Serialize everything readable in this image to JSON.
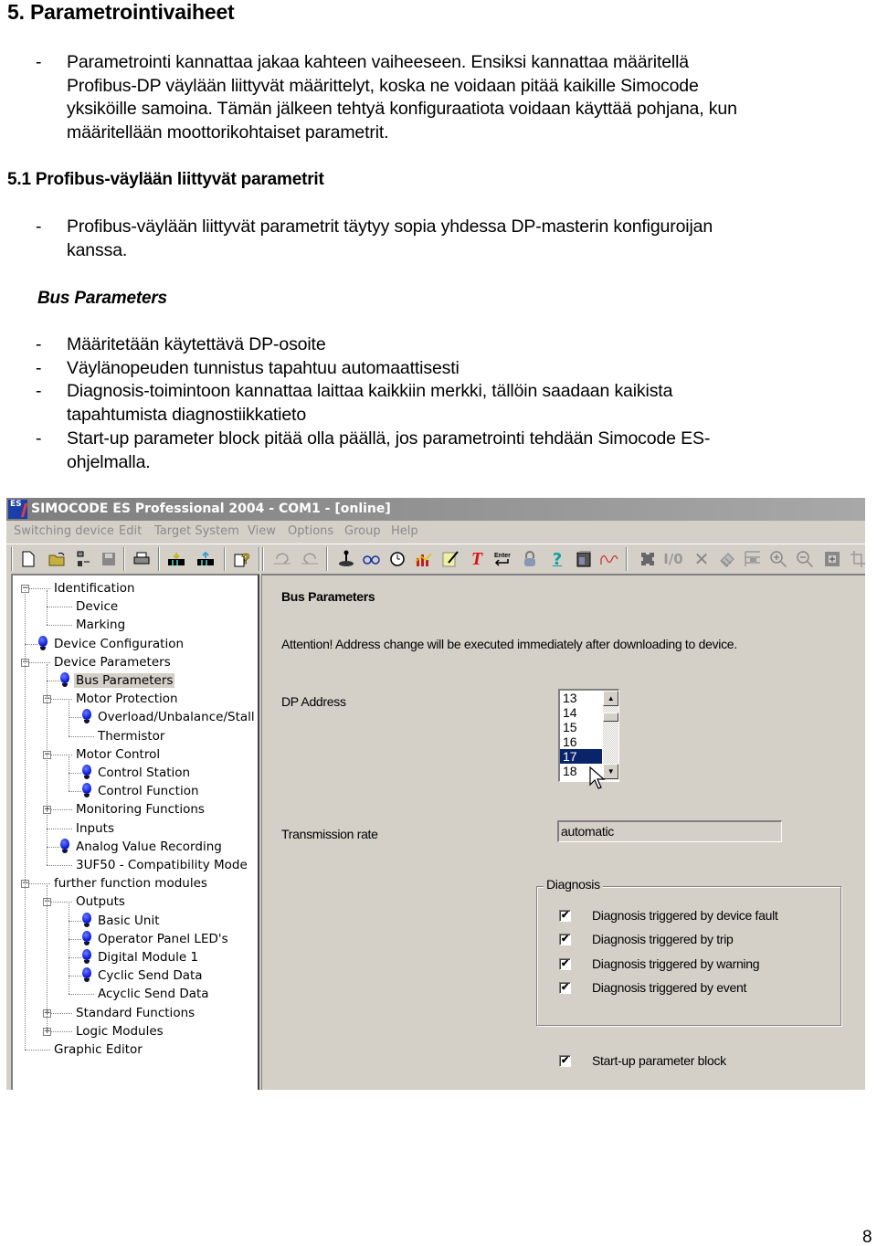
{
  "document": {
    "heading": "5. Parametrointivaiheet",
    "intro_bullets": [
      {
        "dash": "-",
        "lines": [
          "Parametrointi kannattaa jakaa kahteen vaiheeseen. Ensiksi kannattaa määritellä",
          "Profibus-DP väylään liittyvät määrittelyt, koska ne voidaan pitää kaikille Simocode",
          "yksiköille samoina. Tämän jälkeen tehtyä konfiguraatiota voidaan käyttää pohjana, kun",
          "määritellään moottorikohtaiset parametrit."
        ]
      }
    ],
    "subheading": "5.1 Profibus-väylään liittyvät parametrit",
    "sub_bullets": [
      {
        "dash": "-",
        "lines": [
          "Profibus-väylään liittyvät parametrit täytyy sopia yhdessa DP-masterin konfiguroijan",
          "kanssa."
        ]
      }
    ],
    "section_label": "Bus Parameters",
    "bus_bullets": [
      {
        "dash": "-",
        "lines": [
          "Määritetään käytettävä DP-osoite"
        ]
      },
      {
        "dash": "-",
        "lines": [
          "Väylänopeuden tunnistus tapahtuu automaattisesti"
        ]
      },
      {
        "dash": "-",
        "lines": [
          "Diagnosis-toimintoon kannattaa laittaa kaikkiin merkki, tällöin saadaan kaikista",
          "tapahtumista diagnostiikkatieto"
        ]
      },
      {
        "dash": "-",
        "lines": [
          "Start-up parameter block pitää olla päällä, jos parametrointi tehdään Simocode ES-",
          "ohjelmalla."
        ]
      }
    ],
    "page_number": "8"
  },
  "screenshot": {
    "title": "SIMOCODE ES Professional 2004 - COM1 - [online]",
    "app_icon_text": "ES",
    "menu": [
      "Switching device",
      "Edit",
      "Target System",
      "View",
      "Options",
      "Group",
      "Help"
    ],
    "toolbar_icons": [
      "new-document",
      "open-folder",
      "network-connect",
      "save",
      "print",
      "download-to-device",
      "upload-from-device",
      "help-context",
      "undo",
      "redo",
      "joystick-control",
      "glasses-view",
      "stopwatch-test",
      "chart-diagnostics",
      "notepad-edit",
      "text-tool",
      "enter-key",
      "lock",
      "help",
      "device-module",
      "waveform",
      "puzzle-piece",
      "io-toggle",
      "delete",
      "pencil-grid",
      "layout",
      "zoom-in",
      "zoom-out",
      "fit-window",
      "crop"
    ],
    "tree": [
      {
        "label": "Identification",
        "level": 0,
        "expander": "-",
        "bulb": false
      },
      {
        "label": "Device",
        "level": 1,
        "expander": "",
        "bulb": false
      },
      {
        "label": "Marking",
        "level": 1,
        "expander": "",
        "bulb": false
      },
      {
        "label": "Device Configuration",
        "level": 0,
        "expander": "",
        "bulb": true
      },
      {
        "label": "Device Parameters",
        "level": 0,
        "expander": "-",
        "bulb": false
      },
      {
        "label": "Bus Parameters",
        "level": 1,
        "expander": "",
        "bulb": true,
        "selected": true
      },
      {
        "label": "Motor Protection",
        "level": 1,
        "expander": "-",
        "bulb": false
      },
      {
        "label": "Overload/Unbalance/Stall",
        "level": 2,
        "expander": "",
        "bulb": true
      },
      {
        "label": "Thermistor",
        "level": 2,
        "expander": "",
        "bulb": false
      },
      {
        "label": "Motor Control",
        "level": 1,
        "expander": "-",
        "bulb": false
      },
      {
        "label": "Control Station",
        "level": 2,
        "expander": "",
        "bulb": true
      },
      {
        "label": "Control Function",
        "level": 2,
        "expander": "",
        "bulb": true
      },
      {
        "label": "Monitoring Functions",
        "level": 1,
        "expander": "+",
        "bulb": false
      },
      {
        "label": "Inputs",
        "level": 1,
        "expander": "",
        "bulb": false
      },
      {
        "label": "Analog Value Recording",
        "level": 1,
        "expander": "",
        "bulb": true
      },
      {
        "label": "3UF50 - Compatibility Mode",
        "level": 1,
        "expander": "",
        "bulb": false
      },
      {
        "label": "further function modules",
        "level": 0,
        "expander": "-",
        "bulb": false
      },
      {
        "label": "Outputs",
        "level": 1,
        "expander": "-",
        "bulb": false
      },
      {
        "label": "Basic Unit",
        "level": 2,
        "expander": "",
        "bulb": true
      },
      {
        "label": "Operator Panel LED's",
        "level": 2,
        "expander": "",
        "bulb": true
      },
      {
        "label": "Digital Module 1",
        "level": 2,
        "expander": "",
        "bulb": true
      },
      {
        "label": "Cyclic Send Data",
        "level": 2,
        "expander": "",
        "bulb": true
      },
      {
        "label": "Acyclic Send Data",
        "level": 2,
        "expander": "",
        "bulb": false
      },
      {
        "label": "Standard Functions",
        "level": 1,
        "expander": "+",
        "bulb": false
      },
      {
        "label": "Logic Modules",
        "level": 1,
        "expander": "+",
        "bulb": false
      },
      {
        "label": "Graphic Editor",
        "level": 0,
        "expander": "",
        "bulb": false
      }
    ],
    "panel": {
      "title": "Bus Parameters",
      "attention": "Attention! Address change will be executed immediately after downloading to device.",
      "dp_address_label": "DP Address",
      "dp_address_options": [
        "13",
        "14",
        "15",
        "16",
        "17",
        "18"
      ],
      "dp_address_selected": "17",
      "transmission_rate_label": "Transmission rate",
      "transmission_rate_value": "automatic",
      "diagnosis_group_label": "Diagnosis",
      "diagnosis_options": [
        {
          "label": "Diagnosis triggered by device fault",
          "checked": true
        },
        {
          "label": "Diagnosis triggered by trip",
          "checked": true
        },
        {
          "label": "Diagnosis triggered by warning",
          "checked": true
        },
        {
          "label": "Diagnosis triggered by event",
          "checked": true
        }
      ],
      "startup_block": {
        "label": "Start-up parameter block",
        "checked": true
      },
      "check_glyph": "✔"
    }
  }
}
